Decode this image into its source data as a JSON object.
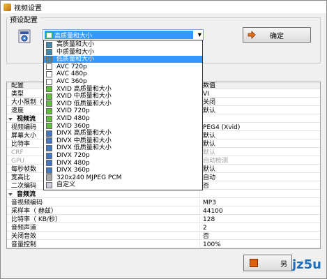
{
  "window": {
    "title": "视频设置"
  },
  "preset_group": {
    "label": "预设配置"
  },
  "preset_combo": {
    "selected": "高质量和大小"
  },
  "ok_button": {
    "label": "确定"
  },
  "dropdown": {
    "items": [
      {
        "label": "高质量和大小",
        "icon": "mpeg-icon",
        "selected": false
      },
      {
        "label": "中质量和大小",
        "icon": "mpeg-icon",
        "selected": false
      },
      {
        "label": "低质量和大小",
        "icon": "mpeg-icon",
        "selected": true
      },
      {
        "label": "AVC 720p",
        "icon": "avc-icon",
        "selected": false
      },
      {
        "label": "AVC 480p",
        "icon": "avc-icon",
        "selected": false
      },
      {
        "label": "AVC 360p",
        "icon": "avc-icon",
        "selected": false
      },
      {
        "label": "XVID 高质量和大小",
        "icon": "xvid-icon",
        "selected": false
      },
      {
        "label": "XVID 中质量和大小",
        "icon": "xvid-icon",
        "selected": false
      },
      {
        "label": "XVID 低质量和大小",
        "icon": "xvid-icon",
        "selected": false
      },
      {
        "label": "XVID 720p",
        "icon": "xvid-icon",
        "selected": false
      },
      {
        "label": "XVID 480p",
        "icon": "xvid-icon",
        "selected": false
      },
      {
        "label": "XVID 360p",
        "icon": "xvid-icon",
        "selected": false
      },
      {
        "label": "DIVX 高质量和大小",
        "icon": "divx-icon",
        "selected": false
      },
      {
        "label": "DIVX 中质量和大小",
        "icon": "divx-icon",
        "selected": false
      },
      {
        "label": "DIVX 低质量和大小",
        "icon": "divx-icon",
        "selected": false
      },
      {
        "label": "DIVX 720p",
        "icon": "divx-icon",
        "selected": false
      },
      {
        "label": "DIVX 480p",
        "icon": "divx-icon",
        "selected": false
      },
      {
        "label": "DIVX 360p",
        "icon": "divx-icon",
        "selected": false
      },
      {
        "label": "320x240 MJPEG PCM",
        "icon": "mjpeg-icon",
        "selected": false
      },
      {
        "label": "自定义",
        "icon": "custom-icon",
        "selected": false
      }
    ]
  },
  "grid": {
    "header": {
      "key": "配置",
      "value": "数值"
    },
    "rows": [
      {
        "key": "类型",
        "value": "VI",
        "type": "row"
      },
      {
        "key": "大小限制（",
        "value": "关闭",
        "type": "row"
      },
      {
        "key": "速度",
        "value": "默认",
        "type": "row"
      },
      {
        "key": "视频流",
        "value": "",
        "type": "cat"
      },
      {
        "key": "视频编码",
        "value": "PEG4 (Xvid)",
        "type": "row"
      },
      {
        "key": "屏幕大小",
        "value": "默认",
        "type": "row"
      },
      {
        "key": "比特率",
        "value": "默认",
        "type": "row"
      },
      {
        "key": "CRF",
        "value": "默认",
        "type": "dis"
      },
      {
        "key": "GPU",
        "value": "自动检测",
        "type": "dis"
      },
      {
        "key": "每秒帧数",
        "value": "默认",
        "type": "row"
      },
      {
        "key": "宽高比",
        "value": "自动",
        "type": "row"
      },
      {
        "key": "二次编码",
        "value": "否",
        "type": "row"
      },
      {
        "key": "音频流",
        "value": "",
        "type": "cat"
      },
      {
        "key": "音视频编码",
        "value": "MP3",
        "type": "row"
      },
      {
        "key": "采样率（ 赫兹）",
        "value": "44100",
        "type": "row"
      },
      {
        "key": "比特率（ KB/秒）",
        "value": "128",
        "type": "row"
      },
      {
        "key": "音频声道",
        "value": "2",
        "type": "row"
      },
      {
        "key": "关闭音效",
        "value": "否",
        "type": "row"
      },
      {
        "key": "音量控制",
        "value": "100%",
        "type": "row"
      }
    ]
  },
  "bottom_button": {
    "label": "另"
  },
  "watermark": {
    "text": "jz5u"
  },
  "colors": {
    "selection": "#3399ff",
    "ok_arrow": "#e07020"
  }
}
